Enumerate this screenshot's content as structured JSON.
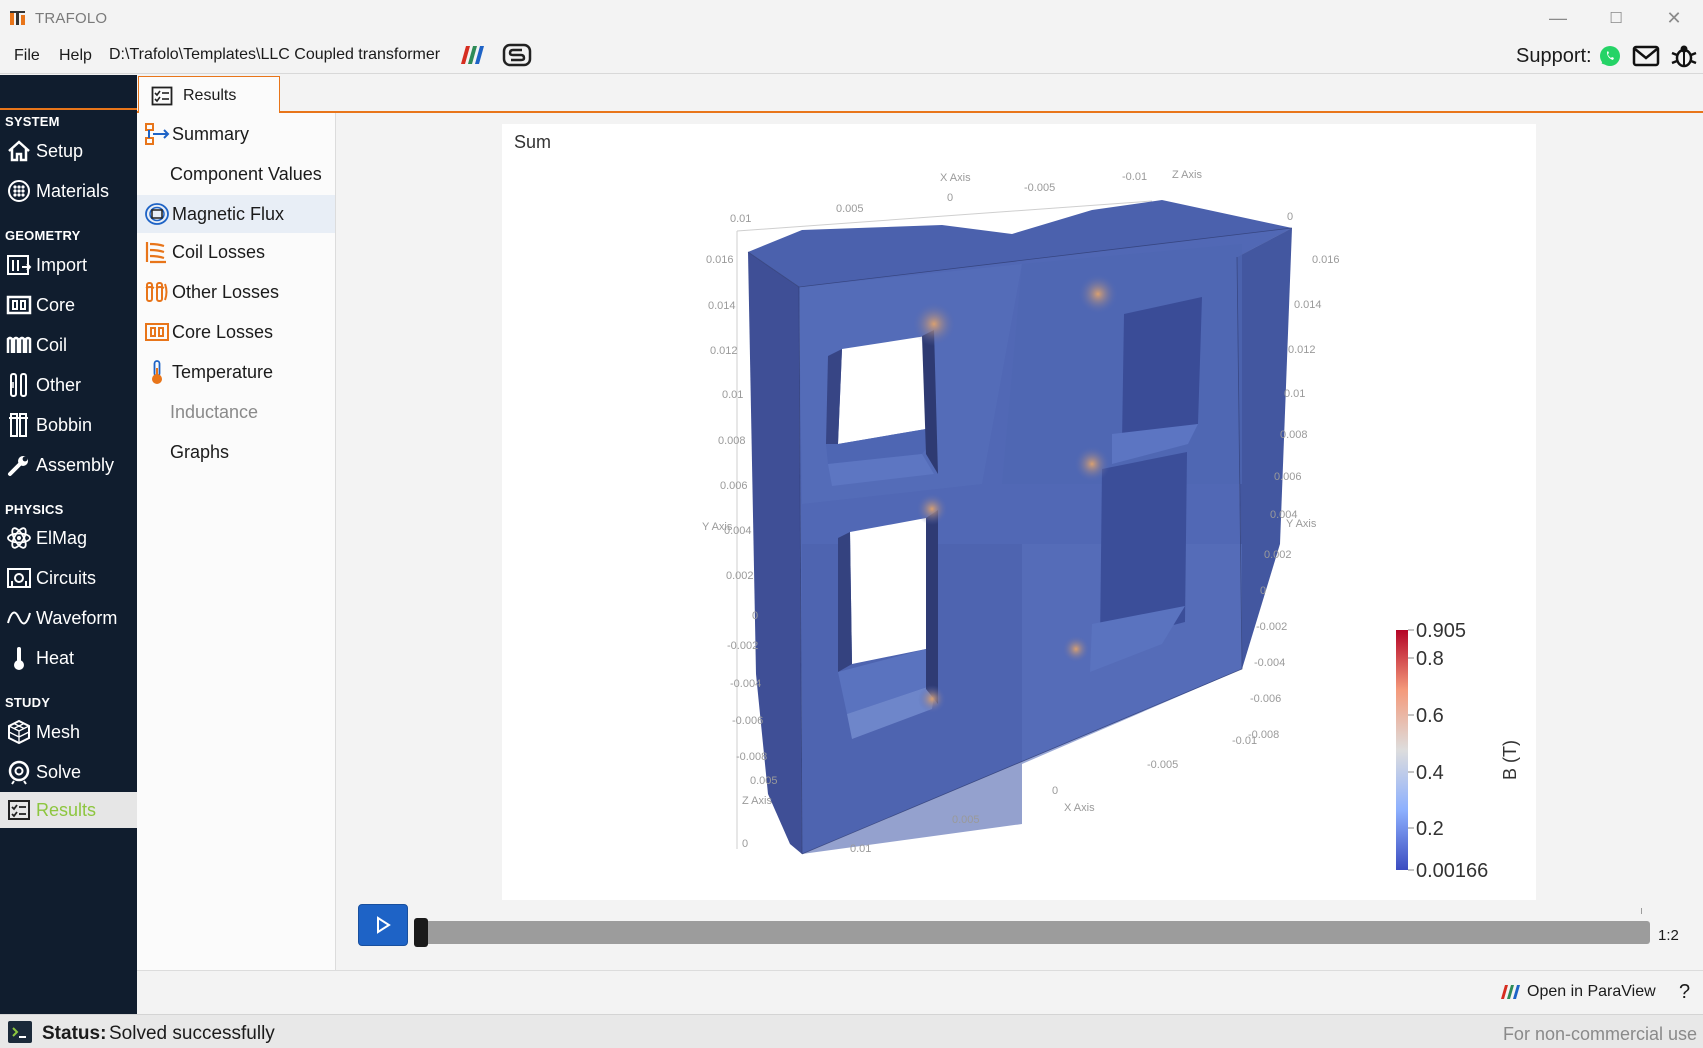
{
  "window": {
    "title": "TRAFOLO",
    "controls": {
      "minimize": "—",
      "maximize": "☐",
      "close": "✕"
    }
  },
  "menu": {
    "file": "File",
    "help": "Help",
    "path": "D:\\Trafolo\\Templates\\LLC Coupled transformer",
    "support": "Support:"
  },
  "nav": {
    "sections": {
      "system": "SYSTEM",
      "geometry": "GEOMETRY",
      "physics": "PHYSICS",
      "study": "STUDY"
    },
    "items": {
      "setup": "Setup",
      "materials": "Materials",
      "import": "Import",
      "core": "Core",
      "coil": "Coil",
      "other": "Other",
      "bobbin": "Bobbin",
      "assembly": "Assembly",
      "elmag": "ElMag",
      "circuits": "Circuits",
      "waveform": "Waveform",
      "heat": "Heat",
      "mesh": "Mesh",
      "solve": "Solve",
      "results": "Results"
    },
    "active_color": "#8dc63f"
  },
  "tab": {
    "results": "Results"
  },
  "results_list": {
    "summary": "Summary",
    "component_values": "Component Values",
    "magnetic_flux": "Magnetic Flux",
    "coil_losses": "Coil Losses",
    "other_losses": "Other Losses",
    "core_losses": "Core Losses",
    "temperature": "Temperature",
    "inductance": "Inductance",
    "graphs": "Graphs",
    "selected": "Magnetic Flux",
    "disabled": "Inductance"
  },
  "viewport": {
    "title": "Sum",
    "colorbar": {
      "label": "B (T)",
      "ticks": [
        "0.905",
        "0.8",
        "0.6",
        "0.4",
        "0.2",
        "0.00166"
      ],
      "min": 0.00166,
      "max": 0.905
    },
    "axes": {
      "x_label": "X Axis",
      "y_label": "Y Axis",
      "z_label": "Z Axis",
      "left_ticks": [
        "0.016",
        "0.014",
        "0.012",
        "0.01",
        "0.008",
        "0.006",
        "0.004",
        "0.002",
        "0",
        "-0.002",
        "-0.004",
        "-0.006",
        "-0.008"
      ],
      "right_ticks": [
        "0.016",
        "0.014",
        "0.012",
        "0.01",
        "0.008",
        "0.006",
        "0.004",
        "0.002",
        "0",
        "-0.002",
        "-0.004",
        "-0.006",
        "-0.008"
      ],
      "top_ticks": [
        "0.01",
        "0.005",
        "0",
        "-0.005",
        "-0.01",
        "0"
      ],
      "bottom_ticks": [
        "0.005",
        "0",
        "0.01",
        "0.005",
        "0",
        "-0.005",
        "-0.01"
      ]
    }
  },
  "player": {
    "frame": "1:2",
    "progress": 0.0
  },
  "footer": {
    "paraview": "Open in ParaView",
    "help": "?"
  },
  "status": {
    "label": "Status:",
    "value": "Solved successfully",
    "license": "For non-commercial use"
  },
  "colors": {
    "nav_bg": "#101d2e",
    "accent_orange": "#e8751a",
    "play_blue": "#1e63c6",
    "mesh_blue": "#4a5fa9"
  }
}
